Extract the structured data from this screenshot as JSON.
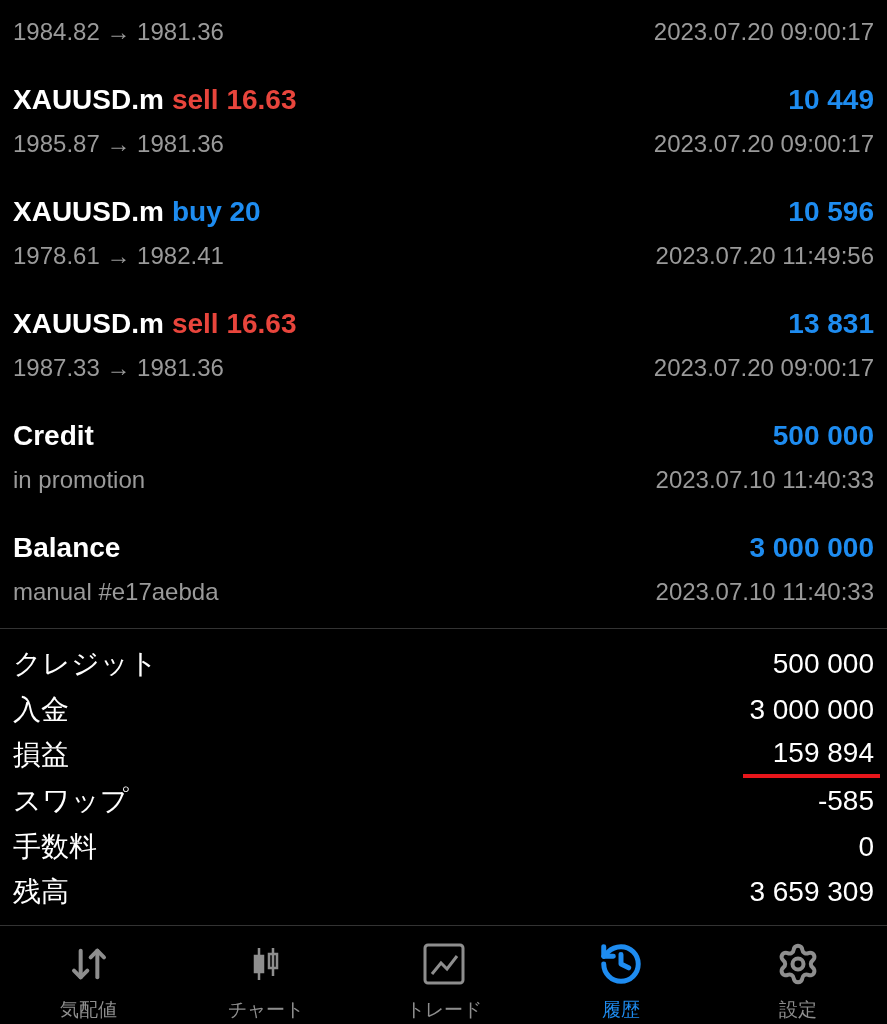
{
  "deals": [
    {
      "detail": "1984.82 → 1981.36",
      "time": "2023.07.20 09:00:17"
    },
    {
      "symbol": "XAUUSD.m",
      "side": {
        "text": "sell 16.63",
        "kind": "sell"
      },
      "amount": "10 449",
      "detail": "1985.87 → 1981.36",
      "time": "2023.07.20 09:00:17"
    },
    {
      "symbol": "XAUUSD.m",
      "side": {
        "text": "buy 20",
        "kind": "buy"
      },
      "amount": "10 596",
      "detail": "1978.61 → 1982.41",
      "time": "2023.07.20 11:49:56"
    },
    {
      "symbol": "XAUUSD.m",
      "side": {
        "text": "sell 16.63",
        "kind": "sell"
      },
      "amount": "13 831",
      "detail": "1987.33 → 1981.36",
      "time": "2023.07.20 09:00:17"
    },
    {
      "symbol": "Credit",
      "amount": "500 000",
      "detail": "in promotion",
      "time": "2023.07.10 11:40:33"
    },
    {
      "symbol": "Balance",
      "amount": "3 000 000",
      "detail": "manual #e17aebda",
      "time": "2023.07.10 11:40:33"
    }
  ],
  "summary": [
    {
      "label": "クレジット",
      "value": "500 000",
      "underlined": false
    },
    {
      "label": "入金",
      "value": "3 000 000",
      "underlined": false
    },
    {
      "label": "損益",
      "value": "159 894",
      "underlined": true
    },
    {
      "label": "スワップ",
      "value": "-585",
      "underlined": false
    },
    {
      "label": "手数料",
      "value": "0",
      "underlined": false
    },
    {
      "label": "残高",
      "value": "3 659 309",
      "underlined": false
    }
  ],
  "tabs": [
    {
      "label": "気配値",
      "kind": "quotes",
      "selected": false
    },
    {
      "label": "チャート",
      "kind": "chart",
      "selected": false
    },
    {
      "label": "トレード",
      "kind": "trade",
      "selected": false
    },
    {
      "label": "履歴",
      "kind": "history",
      "selected": true
    },
    {
      "label": "設定",
      "kind": "settings",
      "selected": false
    }
  ]
}
